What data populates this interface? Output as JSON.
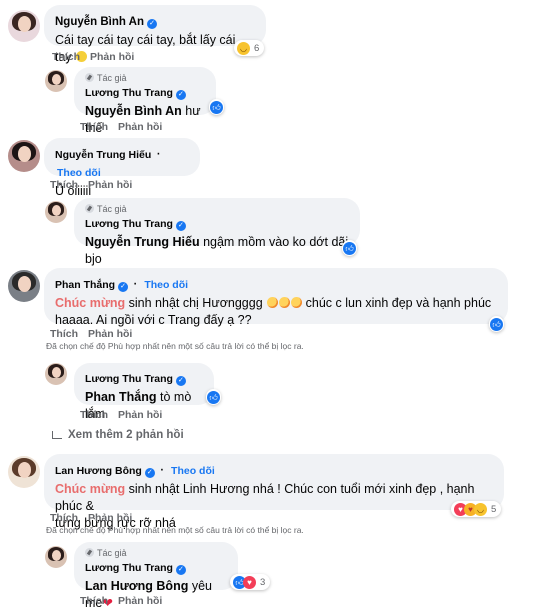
{
  "comments": [
    {
      "id": "c1",
      "name": "Nguyễn Bình An",
      "text": "Cái tay cái tay cái tay, bắt lấy cái tay",
      "reaction_count": "6",
      "actions": [
        "Thích",
        "Phản hồi"
      ],
      "reply": {
        "author_tag": "Tác giả",
        "name": "Lương Thu Trang",
        "mention": "Nguyễn Bình An",
        "text": " hư thế",
        "actions": [
          "Thích",
          "Phản hồi"
        ]
      }
    },
    {
      "id": "c2",
      "name": "Nguyễn Trung Hiếu",
      "follow": "Theo dõi",
      "text": "Ủ ôiiiiii",
      "actions": [
        "Thích",
        "Phản hồi"
      ],
      "reply": {
        "author_tag": "Tác giả",
        "name": "Lương Thu Trang",
        "mention": "Nguyễn Trung Hiếu",
        "text": " ngậm mồm vào ko dớt dãi bjo",
        "actions": [
          "Thích",
          "Phản hồi"
        ]
      }
    },
    {
      "id": "c3",
      "name": "Phan Thắng",
      "follow": "Theo dõi",
      "highlight": "Chúc mừng",
      "text_line1": " sinh nhật chị Hươngggg ",
      "text_line1_end": " chúc c lun xinh đẹp và hạnh phúc",
      "text_line2": "haaaa. Ai ngồi với c Trang đấy ạ ??",
      "actions": [
        "Thích",
        "Phản hồi"
      ],
      "filter_note": "Đã chọn chế độ Phù hợp nhất nên một số câu trả lời có thể bị lọc ra.",
      "reply": {
        "name": "Lương Thu Trang",
        "mention": "Phan Thắng",
        "text": " tò mò lắm",
        "actions": [
          "Thích",
          "Phản hồi"
        ]
      },
      "view_more": "Xem thêm 2 phản hồi"
    },
    {
      "id": "c4",
      "name": "Lan Hương Bông",
      "follow": "Theo dõi",
      "highlight": "Chúc mừng",
      "text_line1": " sinh nhật Linh Hương nhá ! Chúc con tuổi mới xinh đẹp , hạnh phúc &",
      "text_line2": "tưng bừng rực rỡ nhá",
      "reaction_count": "5",
      "actions": [
        "Thích",
        "Phản hồi"
      ],
      "filter_note": "Đã chọn chế độ Phù hợp nhất nên một số câu trả lời có thể bị lọc ra.",
      "reply": {
        "author_tag": "Tác giả",
        "name": "Lương Thu Trang",
        "mention": "Lan Hương Bông",
        "text": " yêu me",
        "reaction_count": "3",
        "actions": [
          "Thích",
          "Phản hồi"
        ]
      }
    }
  ],
  "colors": {
    "bubble": "#f0f2f5",
    "link_blue": "#1877f2",
    "muted": "#65676b",
    "highlight": "#e86d6d"
  },
  "icons": [
    "verified-badge-icon",
    "like-icon",
    "heart-icon",
    "haha-icon",
    "care-icon",
    "author-pen-icon",
    "reply-arrow-icon"
  ]
}
